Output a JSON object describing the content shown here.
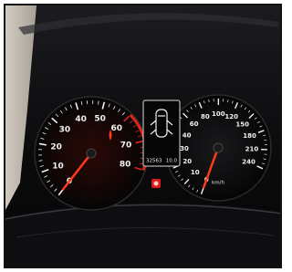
{
  "tachometer": {
    "scale_labels": [
      "0",
      "10",
      "20",
      "30",
      "40",
      "50",
      "60",
      "70",
      "80"
    ],
    "values": [
      0,
      10,
      20,
      30,
      40,
      50,
      60,
      70,
      80
    ],
    "max": 80,
    "needle_value": 0,
    "colors": {
      "ticks": "#f2f2f2",
      "redzone": "#e0251e",
      "needle": "#ff3a1c",
      "glow": "#b01a0f"
    }
  },
  "speedometer": {
    "scale_labels": [
      "0",
      "10",
      "20",
      "30",
      "40",
      "60",
      "80",
      "100",
      "120",
      "150",
      "180",
      "210",
      "240"
    ],
    "values": [
      0,
      10,
      20,
      30,
      40,
      60,
      80,
      100,
      120,
      150,
      180,
      210,
      240
    ],
    "max": 240,
    "needle_value": 0,
    "unit_label": "km/h",
    "colors": {
      "ticks": "#f2f2f2",
      "needle": "#ff3a1c"
    }
  },
  "center_display": {
    "odometer": "32563",
    "trip": "10.0",
    "icon": "car-doors-open-icon",
    "colors": {
      "screen_border": "#d8d8d8",
      "car_outline": "#f0f0f0"
    }
  },
  "warning_lights": [
    {
      "name": "engine-warning-icon",
      "color": "#e01818"
    }
  ],
  "colors": {
    "background": "#ffffff",
    "dash_surface": "#0a0a0c",
    "dash_highlight": "#3a3a3e",
    "left_pillar": "#d6cfc4",
    "bottom_dash": "#151518"
  }
}
